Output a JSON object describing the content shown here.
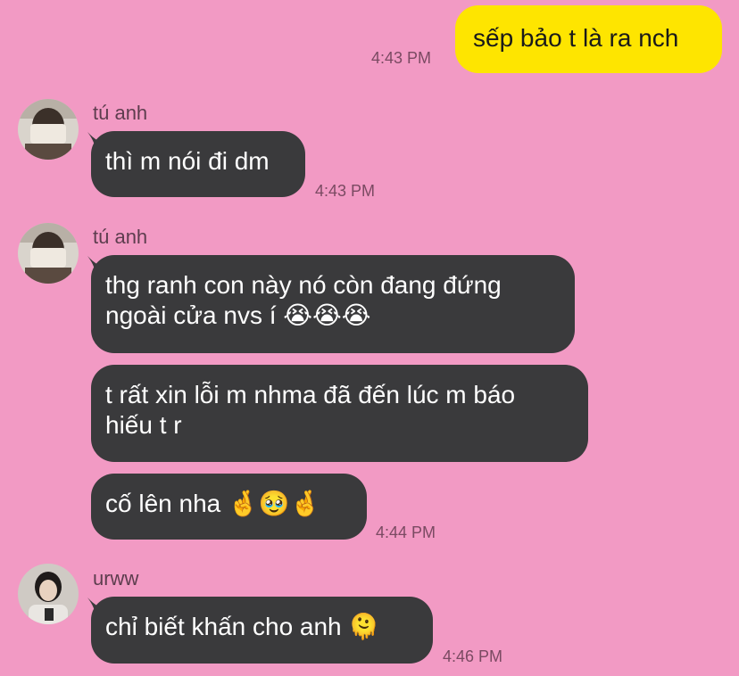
{
  "colors": {
    "background": "#f29ac4",
    "outgoing_bubble": "#fee500",
    "incoming_bubble": "#3a3a3c"
  },
  "messages": {
    "m1": {
      "text": "sếp bảo t là ra nch",
      "time": "4:43 PM"
    },
    "g1": {
      "sender": "tú anh",
      "m2": {
        "text": "thì m nói đi dm",
        "time": "4:43 PM"
      }
    },
    "g2": {
      "sender": "tú anh",
      "m3": {
        "text": "thg ranh con này nó còn đang đứng\nngoài cửa nvs í 😭😭😭"
      },
      "m4": {
        "text": "t rất xin lỗi m nhma đã đến lúc m báo\nhiếu t r"
      },
      "m5": {
        "text": "cố lên nha 🤞🥹🤞",
        "time": "4:44 PM"
      }
    },
    "g3": {
      "sender": "urww",
      "m6": {
        "text": "chỉ biết khấn cho anh 🫠",
        "time": "4:46 PM"
      }
    }
  },
  "icons": {
    "avatar_tu_anh": "avatar-photo-icon",
    "avatar_urww": "avatar-photo-icon"
  }
}
